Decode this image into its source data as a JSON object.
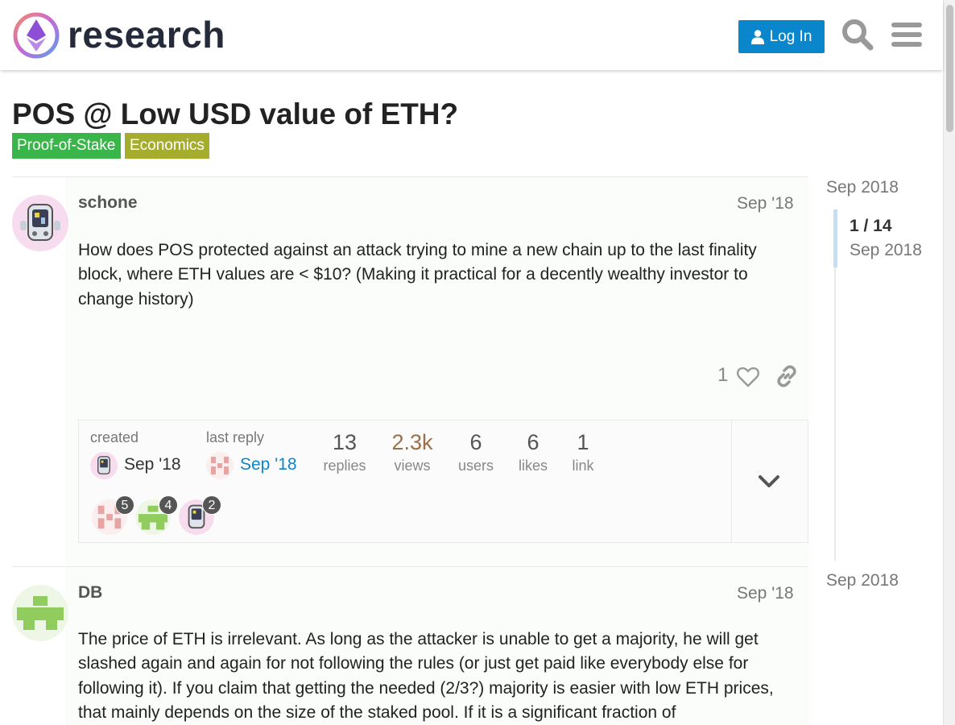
{
  "header": {
    "site_name": "research",
    "login_label": "Log In",
    "icons": [
      "user-icon",
      "search-icon",
      "hamburger-menu-icon"
    ]
  },
  "topic": {
    "title": "POS @ Low USD value of ETH?",
    "tags": [
      {
        "label": "Proof-of-Stake",
        "color": "#3ab54a"
      },
      {
        "label": "Economics",
        "color": "#a6ac2c"
      }
    ]
  },
  "posts": [
    {
      "username": "schone",
      "date": "Sep '18",
      "text": "How does POS protected against an attack trying to mine a new chain up to the last finality block, where ETH values are < $10? (Making it practical for a decently wealthy investor to change history)",
      "likes": "1"
    },
    {
      "username": "DB",
      "date": "Sep '18",
      "text": "The price of ETH is irrelevant. As long as the attacker is unable to get a majority, he will get slashed again and again for not following the rules (or just get paid like everybody else for following it). If you claim that getting the needed (2/3?) majority is easier with low ETH prices, that mainly depends on the size of the staked pool. If it is a significant fraction of"
    }
  ],
  "topic_map": {
    "created_label": "created",
    "created_date": "Sep '18",
    "last_reply_label": "last reply",
    "last_reply_date": "Sep '18",
    "stats": [
      {
        "value": "13",
        "label": "replies"
      },
      {
        "value": "2.3k",
        "label": "views"
      },
      {
        "value": "6",
        "label": "users"
      },
      {
        "value": "6",
        "label": "likes"
      },
      {
        "value": "1",
        "label": "link"
      }
    ],
    "participants": [
      {
        "count": "5"
      },
      {
        "count": "4"
      },
      {
        "count": "2"
      }
    ]
  },
  "timeline": {
    "start_label": "Sep 2018",
    "position": "1 / 14",
    "position_date": "Sep 2018",
    "end_label": "Sep 2018"
  },
  "colors": {
    "accent": "#0a86cc",
    "views_highlight": "#9b7047"
  }
}
